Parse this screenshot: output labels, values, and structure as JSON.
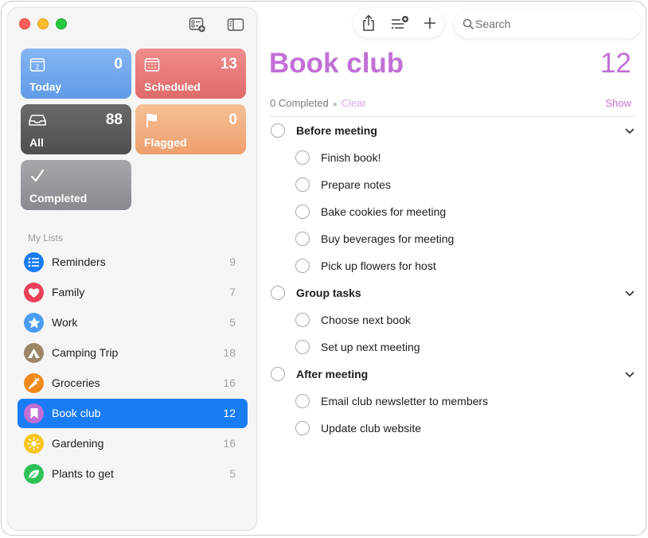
{
  "sidebar": {
    "smart_lists": {
      "today": {
        "label": "Today",
        "count": "0"
      },
      "scheduled": {
        "label": "Scheduled",
        "count": "13"
      },
      "all": {
        "label": "All",
        "count": "88"
      },
      "flagged": {
        "label": "Flagged",
        "count": "0"
      },
      "completed": {
        "label": "Completed"
      }
    },
    "my_lists_header": "My Lists",
    "lists": [
      {
        "name": "Reminders",
        "count": "9",
        "color": "#1a7cf5",
        "icon": "list-bullet-icon"
      },
      {
        "name": "Family",
        "count": "7",
        "color": "#ec3f5a",
        "icon": "heart-icon"
      },
      {
        "name": "Work",
        "count": "5",
        "color": "#4a9cf2",
        "icon": "star-icon"
      },
      {
        "name": "Camping Trip",
        "count": "18",
        "color": "#9c8766",
        "icon": "tent-icon"
      },
      {
        "name": "Groceries",
        "count": "16",
        "color": "#f08a1c",
        "icon": "carrot-icon"
      },
      {
        "name": "Book club",
        "count": "12",
        "color": "#c26fd6",
        "icon": "bookmark-icon",
        "selected": true
      },
      {
        "name": "Gardening",
        "count": "16",
        "color": "#f7c51e",
        "icon": "sun-icon"
      },
      {
        "name": "Plants to get",
        "count": "5",
        "color": "#2fc158",
        "icon": "leaf-icon"
      }
    ]
  },
  "toolbar": {
    "search_placeholder": "Search"
  },
  "main": {
    "title": "Book club",
    "count": "12",
    "accent": "#c26fd6",
    "completed_text": "0 Completed",
    "clear_label": "Clear",
    "show_label": "Show",
    "groups": [
      {
        "title": "Before meeting",
        "items": [
          "Finish book!",
          "Prepare notes",
          "Bake cookies for meeting",
          "Buy beverages for meeting",
          "Pick up flowers for host"
        ]
      },
      {
        "title": "Group tasks",
        "items": [
          "Choose next book",
          "Set up next meeting"
        ]
      },
      {
        "title": "After meeting",
        "items": [
          "Email club newsletter to members",
          "Update club website"
        ]
      }
    ]
  }
}
